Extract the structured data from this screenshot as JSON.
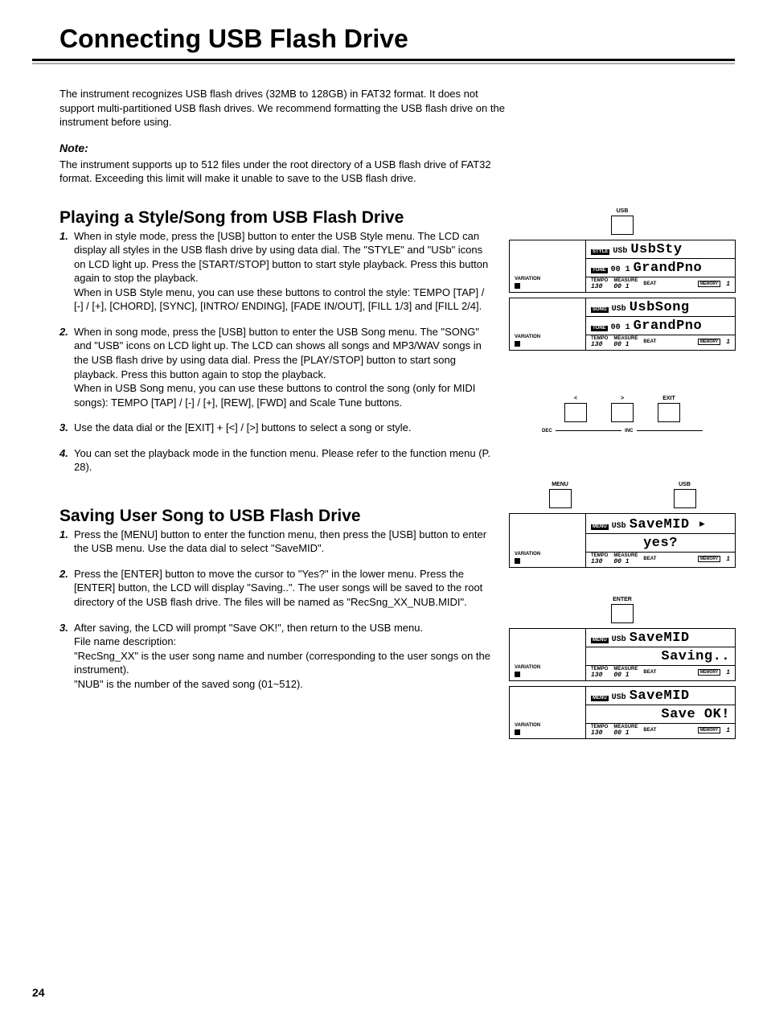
{
  "page": {
    "title": "Connecting USB Flash Drive",
    "number": "24"
  },
  "intro": {
    "p1": "The instrument recognizes USB flash drives (32MB to 128GB) in FAT32 format. It does not support multi-partitioned USB flash drives. We recommend formatting the USB flash drive on the instrument before using.",
    "noteHead": "Note:",
    "note": "The instrument supports up to 512 files under the root directory of a USB flash drive of FAT32 format. Exceeding this limit will make it unable to save to the USB flash drive."
  },
  "section1": {
    "heading": "Playing a Style/Song from USB Flash Drive",
    "steps": [
      {
        "n": "1.",
        "t": "When in style mode, press the [USB] button to enter the USB Style menu. The LCD can display all styles in the USB flash drive by using data dial. The \"STYLE\" and \"USb\" icons on LCD light up. Press the [START/STOP] button to start style playback. Press this button again to stop the playback.\nWhen in USB Style menu, you can use these buttons to control the style: TEMPO [TAP] / [-] / [+], [CHORD], [SYNC], [INTRO/ ENDING], [FADE IN/OUT], [FILL 1/3] and [FILL 2/4]."
      },
      {
        "n": "2.",
        "t": "When in song mode, press the [USB] button to enter the USB Song menu. The \"SONG\" and \"USB\" icons on LCD light up. The LCD can shows all songs and MP3/WAV songs in the USB flash drive by using data dial. Press the [PLAY/STOP] button to start song playback. Press this button again to stop the playback.\nWhen in USB Song menu, you can use these buttons to control the song (only for MIDI songs): TEMPO [TAP] / [-] / [+], [REW], [FWD] and Scale Tune buttons."
      },
      {
        "n": "3.",
        "t": "Use the data dial or the [EXIT] + [<] / [>] buttons to select a song or style."
      },
      {
        "n": "4.",
        "t": "You can set the playback mode in the function menu. Please refer to the function menu (P. 28)."
      }
    ]
  },
  "section2": {
    "heading": "Saving User Song to USB Flash Drive",
    "steps": [
      {
        "n": "1.",
        "t": "Press the [MENU] button to enter the function menu, then press the [USB] button to enter the USB menu. Use the data dial to select \"SaveMID\"."
      },
      {
        "n": "2.",
        "t": "Press the [ENTER] button to move the cursor to \"Yes?\" in the lower menu. Press the [ENTER] button, the LCD will display \"Saving..\". The user songs will be saved to the root directory of the USB flash drive. The files will be named as \"RecSng_XX_NUB.MIDI\"."
      },
      {
        "n": "3.",
        "t": "After saving, the LCD will prompt \"Save OK!\", then return to the USB menu.\nFile name description:\n\"RecSng_XX\" is the user song name and number (corresponding to the user songs on the instrument).\n\"NUB\" is the number of the saved song (01~512)."
      }
    ]
  },
  "buttons": {
    "usb": "USB",
    "menu": "MENU",
    "enter": "ENTER",
    "exit": "EXIT",
    "lt": "<",
    "gt": ">",
    "dec": "DEC",
    "inc": "INC"
  },
  "lcd": {
    "variation": "VARIATION",
    "tempo": "TEMPO",
    "measure": "MEASURE",
    "beat": "BEAT",
    "memory": "MEMORY",
    "tempoVal": "130",
    "measureVal": "00 1",
    "beatVal": "1",
    "style": "STYLE",
    "song": "SONG",
    "tone": "TONE",
    "menu": "MENU",
    "usb": "USb",
    "styMain": "UsbSty",
    "tonePrefix": "00 1",
    "toneName": "GrandPno",
    "songMain": "UsbSong",
    "saveMain": "SaveMID",
    "saveMainArrow": "SaveMID ▸",
    "yes": "yes?",
    "saving": "Saving..",
    "saveok": "Save OK!"
  }
}
